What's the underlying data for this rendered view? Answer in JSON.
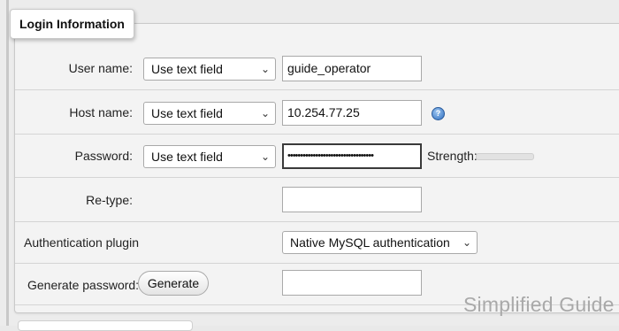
{
  "legend": "Login Information",
  "rows": {
    "username": {
      "label": "User name:",
      "select_value": "Use text field",
      "input_value": "guide_operator"
    },
    "hostname": {
      "label": "Host name:",
      "select_value": "Use text field",
      "input_value": "10.254.77.25",
      "help_icon": "help-icon"
    },
    "password": {
      "label": "Password:",
      "select_value": "Use text field",
      "input_value": "••••••••••••••••••••••••••••••••••",
      "strength_label": "Strength:"
    },
    "retype": {
      "label": "Re-type:",
      "input_value": ""
    },
    "auth_plugin": {
      "label": "Authentication plugin",
      "select_value": "Native MySQL authentication"
    },
    "generate": {
      "label": "Generate password:",
      "button_label": "Generate",
      "input_value": ""
    }
  },
  "watermark": "Simplified Guide",
  "colors": {
    "background": "#ececec",
    "panel": "#f3f3f3",
    "help_icon": "#2f6fbf"
  }
}
